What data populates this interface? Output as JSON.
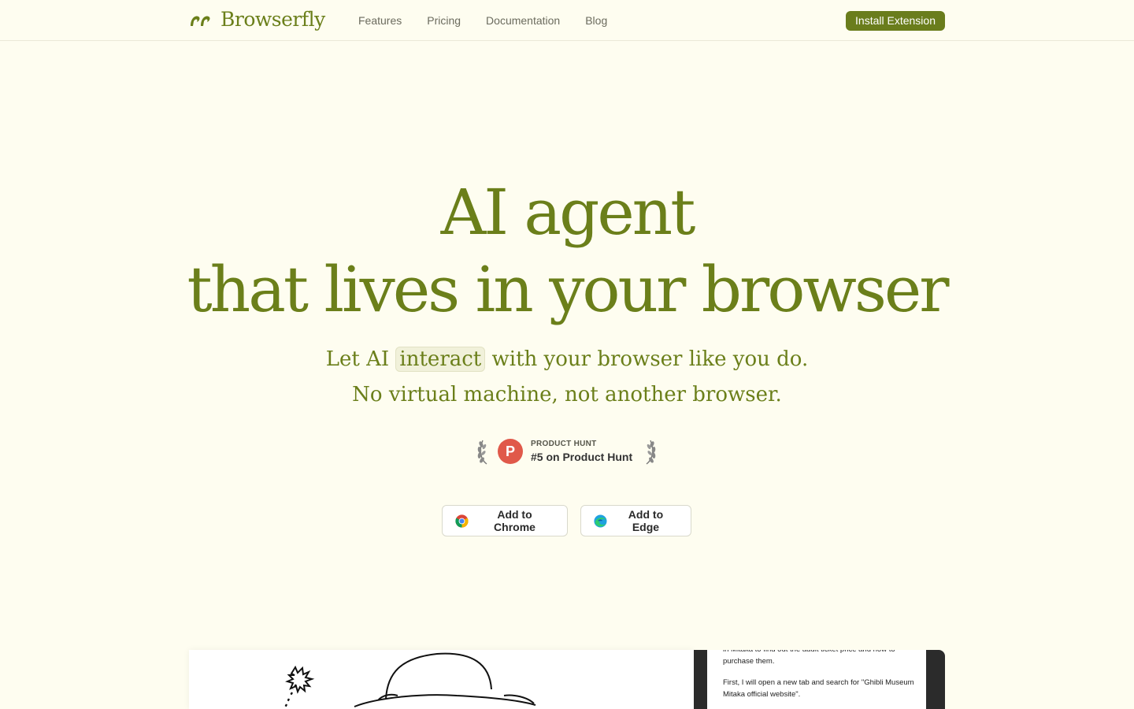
{
  "nav": {
    "brand": "Browserfly",
    "links": [
      "Features",
      "Pricing",
      "Documentation",
      "Blog"
    ],
    "install_label": "Install Extension"
  },
  "hero": {
    "line1": "AI agent",
    "line2": "that lives in your browser",
    "sub1_pre": "Let AI",
    "sub1_highlight": "interact",
    "sub1_post": "with your browser like you do.",
    "sub2": "No virtual machine, not another browser."
  },
  "product_hunt": {
    "logo_letter": "P",
    "label": "PRODUCT HUNT",
    "rank": "#5 on Product Hunt"
  },
  "buttons": {
    "chrome": "Add to Chrome",
    "edge": "Add to Edge"
  },
  "preview": {
    "chat_line1": "in Mitaka to find out the adult ticket price and how to purchase them.",
    "chat_line2": "First, I will open a new tab and search for \"Ghibli Museum Mitaka official website\"."
  },
  "colors": {
    "accent": "#6b7f1a",
    "background": "#fefdf0",
    "install_button": "#6a7d1c"
  }
}
